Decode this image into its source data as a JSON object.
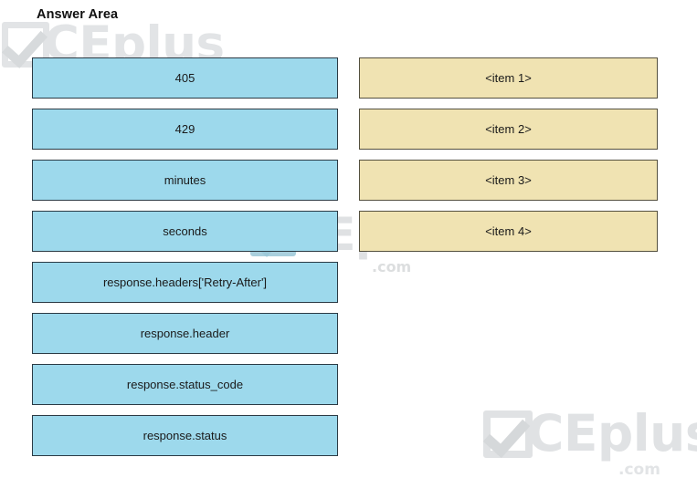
{
  "page": {
    "title": "Answer Area"
  },
  "source_column": {
    "name": "draggable-options",
    "items": [
      {
        "label": "405"
      },
      {
        "label": "429"
      },
      {
        "label": "minutes"
      },
      {
        "label": "seconds"
      },
      {
        "label": "response.headers['Retry-After']"
      },
      {
        "label": "response.header"
      },
      {
        "label": "response.status_code"
      },
      {
        "label": "response.status"
      }
    ]
  },
  "target_column": {
    "name": "drop-targets",
    "items": [
      {
        "label": "<item 1>"
      },
      {
        "label": "<item 2>"
      },
      {
        "label": "<item 3>"
      },
      {
        "label": "<item 4>"
      }
    ]
  },
  "watermarks": [
    {
      "text": "CEplus",
      "suffix": ".com",
      "icon": "checkmark-icon"
    },
    {
      "text": "CEplus",
      "suffix": ".com",
      "icon": "checkmark-icon"
    },
    {
      "text": "CEplus",
      "suffix": ".com",
      "icon": "checkmark-icon"
    }
  ],
  "colors": {
    "source_fill": "#9DD9EC",
    "source_border": "#2b3a44",
    "target_fill": "#F0E3B2",
    "target_border": "#54503f",
    "background": "#ffffff",
    "text": "#1a1a1a"
  }
}
